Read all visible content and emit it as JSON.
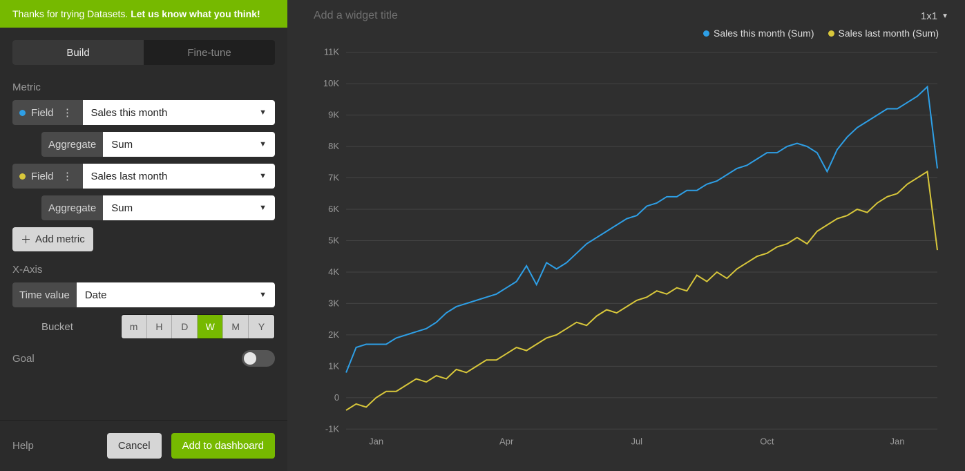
{
  "banner": {
    "text": "Thanks for trying Datasets. ",
    "link": "Let us know what you think!"
  },
  "tabs": {
    "build": "Build",
    "finetune": "Fine-tune",
    "active": "build"
  },
  "labels": {
    "metric": "Metric",
    "field": "Field",
    "aggregate": "Aggregate",
    "add_metric": "Add metric",
    "xaxis": "X-Axis",
    "time_value": "Time value",
    "bucket": "Bucket",
    "goal": "Goal",
    "help": "Help",
    "cancel": "Cancel",
    "add_dash": "Add to dashboard"
  },
  "metrics": [
    {
      "color": "#2e9fe6",
      "field": "Sales this month",
      "aggregate": "Sum"
    },
    {
      "color": "#d8c73b",
      "field": "Sales last month",
      "aggregate": "Sum"
    }
  ],
  "xaxis": {
    "field": "Date"
  },
  "buckets": {
    "options": [
      "m",
      "H",
      "D",
      "W",
      "M",
      "Y"
    ],
    "active": "W"
  },
  "goal": {
    "on": false
  },
  "widget": {
    "title_placeholder": "Add a widget title",
    "size": "1x1"
  },
  "legend": [
    {
      "color": "#2e9fe6",
      "label": "Sales this month (Sum)"
    },
    {
      "color": "#d8c73b",
      "label": "Sales last month (Sum)"
    }
  ],
  "chart_data": {
    "type": "line",
    "xlabel": "",
    "ylabel": "",
    "ylim": [
      -1000,
      11000
    ],
    "y_ticks": [
      -1000,
      0,
      1000,
      2000,
      3000,
      4000,
      5000,
      6000,
      7000,
      8000,
      9000,
      10000,
      11000
    ],
    "y_tick_labels": [
      "-1K",
      "0",
      "1K",
      "2K",
      "3K",
      "4K",
      "5K",
      "6K",
      "7K",
      "8K",
      "9K",
      "10K",
      "11K"
    ],
    "x_tick_positions": [
      3,
      16,
      29,
      42,
      55
    ],
    "x_tick_labels": [
      "Jan",
      "Apr",
      "Jul",
      "Oct",
      "Jan"
    ],
    "x_count": 60,
    "series": [
      {
        "name": "Sales this month (Sum)",
        "color": "#2e9fe6",
        "values": [
          800,
          1600,
          1700,
          1700,
          1700,
          1900,
          2000,
          2100,
          2200,
          2400,
          2700,
          2900,
          3000,
          3100,
          3200,
          3300,
          3500,
          3700,
          4200,
          3600,
          4300,
          4100,
          4300,
          4600,
          4900,
          5100,
          5300,
          5500,
          5700,
          5800,
          6100,
          6200,
          6400,
          6400,
          6600,
          6600,
          6800,
          6900,
          7100,
          7300,
          7400,
          7600,
          7800,
          7800,
          8000,
          8100,
          8000,
          7800,
          7200,
          7900,
          8300,
          8600,
          8800,
          9000,
          9200,
          9200,
          9400,
          9600,
          9900,
          7300
        ]
      },
      {
        "name": "Sales last month (Sum)",
        "color": "#d8c73b",
        "values": [
          -400,
          -200,
          -300,
          0,
          200,
          200,
          400,
          600,
          500,
          700,
          600,
          900,
          800,
          1000,
          1200,
          1200,
          1400,
          1600,
          1500,
          1700,
          1900,
          2000,
          2200,
          2400,
          2300,
          2600,
          2800,
          2700,
          2900,
          3100,
          3200,
          3400,
          3300,
          3500,
          3400,
          3900,
          3700,
          4000,
          3800,
          4100,
          4300,
          4500,
          4600,
          4800,
          4900,
          5100,
          4900,
          5300,
          5500,
          5700,
          5800,
          6000,
          5900,
          6200,
          6400,
          6500,
          6800,
          7000,
          7200,
          4700
        ]
      }
    ]
  }
}
